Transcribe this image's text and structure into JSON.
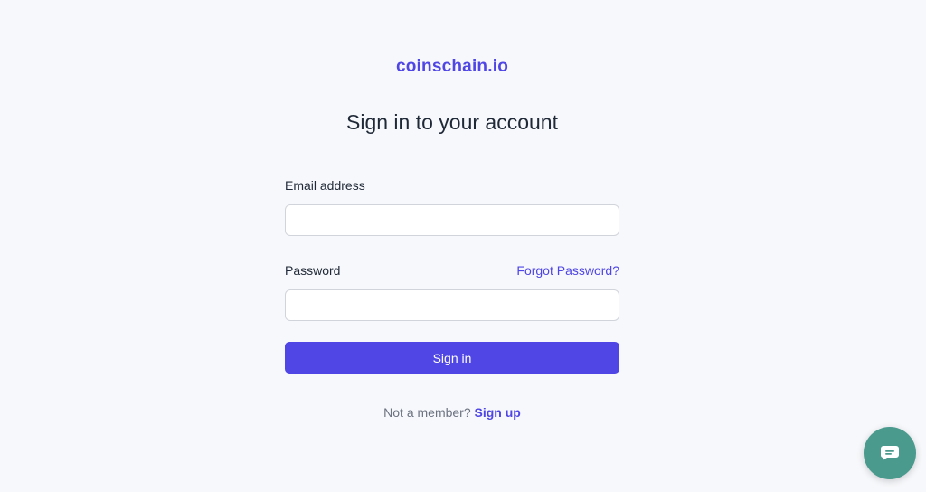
{
  "brand": {
    "name": "coinschain.io"
  },
  "heading": "Sign in to your account",
  "form": {
    "email_label": "Email address",
    "email_value": "",
    "password_label": "Password",
    "password_value": "",
    "forgot_link": "Forgot Password?",
    "signin_label": "Sign in"
  },
  "footer": {
    "prompt": "Not a member?",
    "signup_link": "Sign up"
  },
  "chat": {
    "icon": "chat-icon"
  },
  "colors": {
    "accent": "#4f46e5",
    "background": "#f7f8fb",
    "chat": "#4a9a8e"
  }
}
